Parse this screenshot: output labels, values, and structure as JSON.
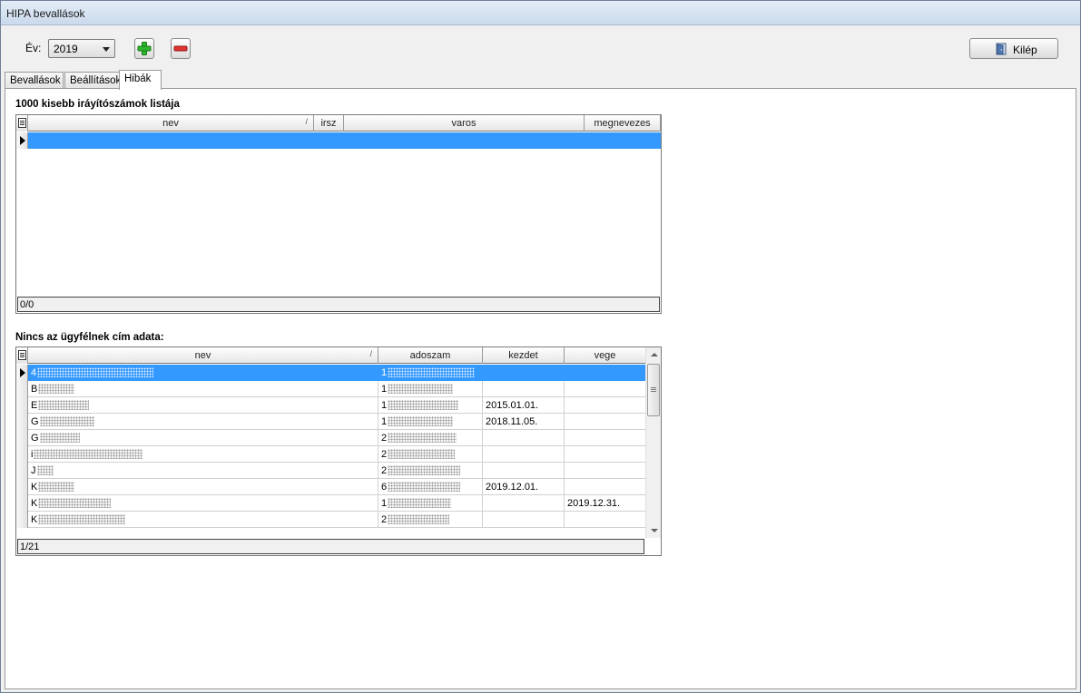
{
  "window": {
    "title": "HIPA bevallások"
  },
  "toolbar": {
    "year_label": "Év:",
    "year_value": "2019",
    "add_icon": "plus-icon",
    "remove_icon": "minus-icon",
    "exit_label": "Kilép",
    "exit_icon": "door-icon",
    "colors": {
      "add": "#22a822",
      "remove": "#d62b2b"
    }
  },
  "tabs": [
    {
      "label": "Bevallások",
      "active": false
    },
    {
      "label": "Beállítások",
      "active": false
    },
    {
      "label": "Hibák",
      "active": true
    }
  ],
  "grid1": {
    "title": "1000 kisebb iráyítószámok listája",
    "columns": [
      "nev",
      "irsz",
      "varos",
      "megnevezes"
    ],
    "rows": [
      {
        "nev": "",
        "irsz": "",
        "varos": "",
        "megnevezes": ""
      }
    ],
    "footer": "0/0"
  },
  "grid2": {
    "title": "Nincs az ügyfélnek cím adata:",
    "columns": [
      "nev",
      "adoszam",
      "kezdet",
      "vege"
    ],
    "rows": [
      {
        "nev": "4",
        "adoszam": "1",
        "kezdet": "",
        "vege": ""
      },
      {
        "nev": "B",
        "adoszam": "1",
        "kezdet": "",
        "vege": ""
      },
      {
        "nev": "E",
        "adoszam": "1",
        "kezdet": "2015.01.01.",
        "vege": ""
      },
      {
        "nev": "G",
        "adoszam": "1",
        "kezdet": "2018.11.05.",
        "vege": ""
      },
      {
        "nev": "G",
        "adoszam": "2",
        "kezdet": "",
        "vege": ""
      },
      {
        "nev": "i",
        "adoszam": "2",
        "kezdet": "",
        "vege": ""
      },
      {
        "nev": "J",
        "adoszam": "2",
        "kezdet": "",
        "vege": ""
      },
      {
        "nev": "K",
        "adoszam": "6",
        "kezdet": "2019.12.01.",
        "vege": ""
      },
      {
        "nev": "K",
        "adoszam": "1",
        "kezdet": "",
        "vege": "2019.12.31."
      },
      {
        "nev": "K",
        "adoszam": "2",
        "kezdet": "",
        "vege": ""
      }
    ],
    "footer": "1/21"
  },
  "selection_color": "#3399ff"
}
